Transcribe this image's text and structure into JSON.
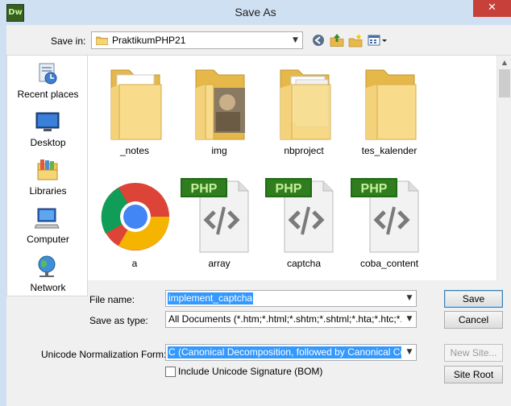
{
  "window": {
    "app_icon_text": "Dw",
    "title": "Save As",
    "close_glyph": "✕"
  },
  "save_in": {
    "label": "Save in:",
    "value": "PraktikumPHP21"
  },
  "places": [
    {
      "label": "Recent places",
      "icon": "recent-places-icon"
    },
    {
      "label": "Desktop",
      "icon": "desktop-icon"
    },
    {
      "label": "Libraries",
      "icon": "libraries-icon"
    },
    {
      "label": "Computer",
      "icon": "computer-icon"
    },
    {
      "label": "Network",
      "icon": "network-icon"
    }
  ],
  "files": [
    {
      "label": "_notes",
      "icon": "folder-icon"
    },
    {
      "label": "img",
      "icon": "folder-image-icon"
    },
    {
      "label": "nbproject",
      "icon": "folder-icon"
    },
    {
      "label": "tes_kalender",
      "icon": "folder-icon"
    },
    {
      "label": "a",
      "icon": "chrome-icon"
    },
    {
      "label": "array",
      "icon": "php-file-icon",
      "badge": "PHP"
    },
    {
      "label": "captcha",
      "icon": "php-file-icon",
      "badge": "PHP"
    },
    {
      "label": "coba_content",
      "icon": "php-file-icon",
      "badge": "PHP"
    }
  ],
  "form": {
    "file_name_label": "File name:",
    "file_name_value": "implement_captcha",
    "save_as_type_label": "Save as type:",
    "save_as_type_value": "All Documents (*.htm;*.html;*.shtm;*.shtml;*.hta;*.htc;*.xhtml;*.s",
    "unicode_label": "Unicode Normalization Form:",
    "unicode_value": "C (Canonical Decomposition, followed by Canonical Composi",
    "bom_label": "Include Unicode Signature (BOM)",
    "bom_checked": false
  },
  "buttons": {
    "save": "Save",
    "cancel": "Cancel",
    "new_site": "New Site...",
    "site_root": "Site Root"
  },
  "colors": {
    "selection": "#3399ff",
    "folder": "#f0c75e",
    "php_badge": "#2f7d1f",
    "close_button": "#c7403a"
  }
}
